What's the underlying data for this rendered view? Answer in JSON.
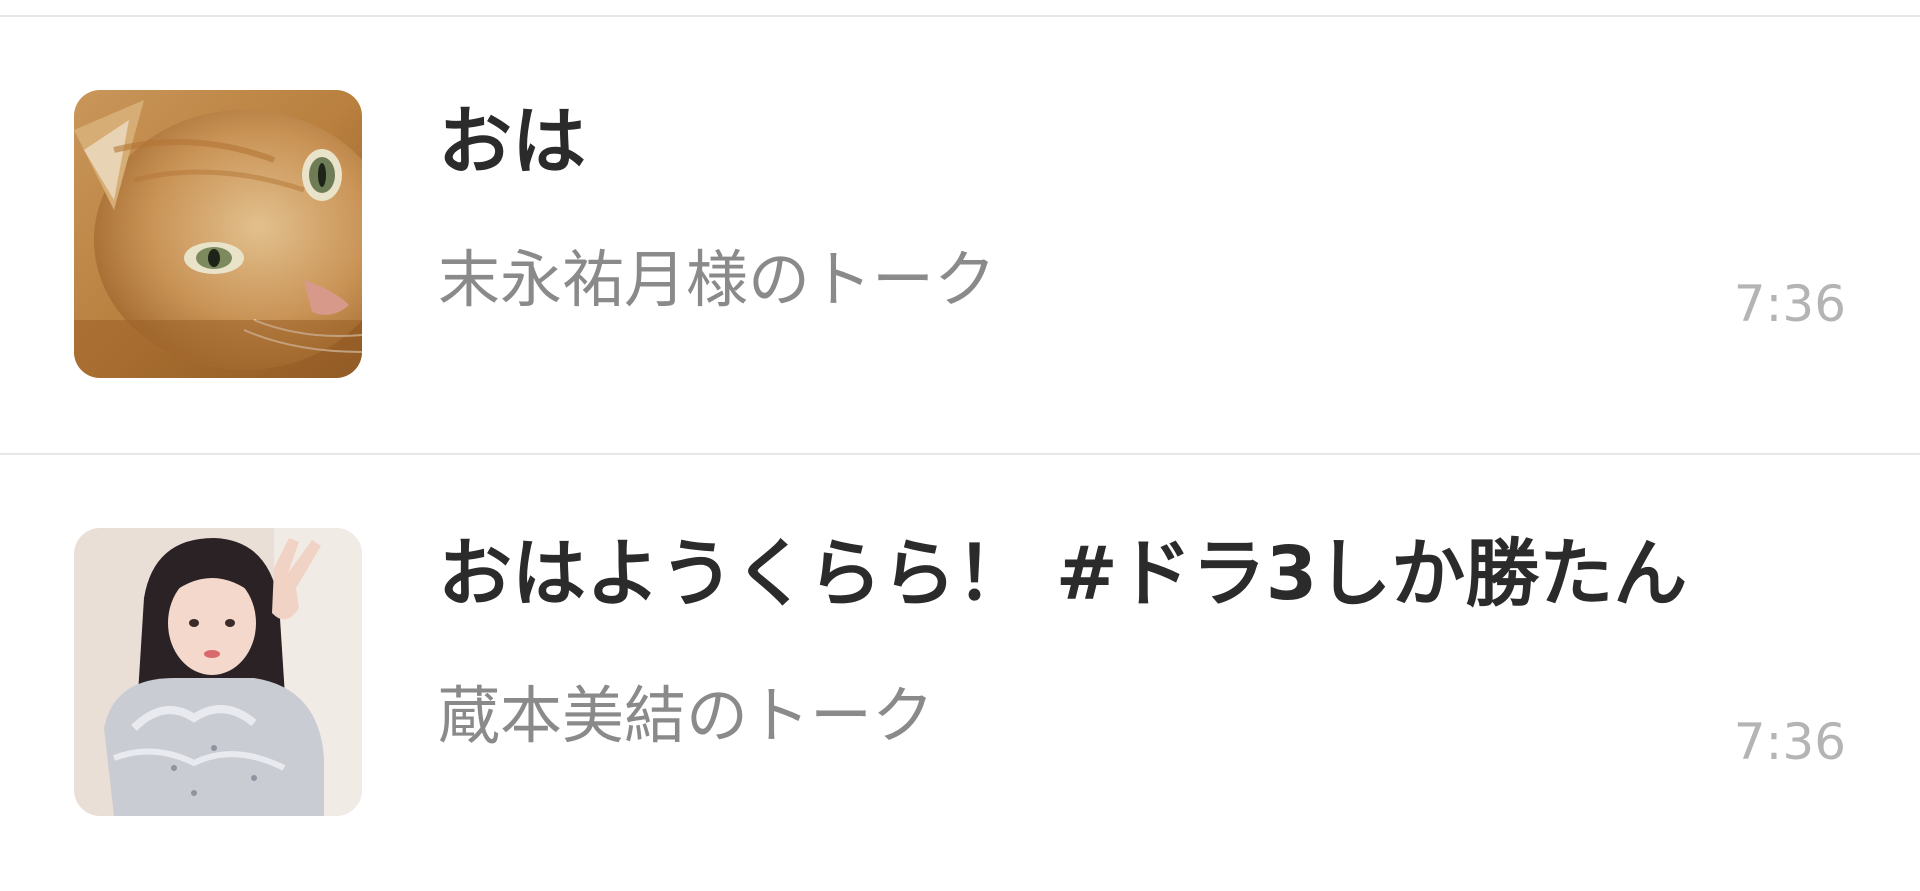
{
  "messages": [
    {
      "title": "おは",
      "sender": "末永祐月様のトーク",
      "time": "7:36",
      "avatar": "cat-photo"
    },
    {
      "title": "おはようくらら！ #ドラ3しか勝たん",
      "sender": "蔵本美結のトーク",
      "time": "7:36",
      "avatar": "person-photo"
    }
  ]
}
